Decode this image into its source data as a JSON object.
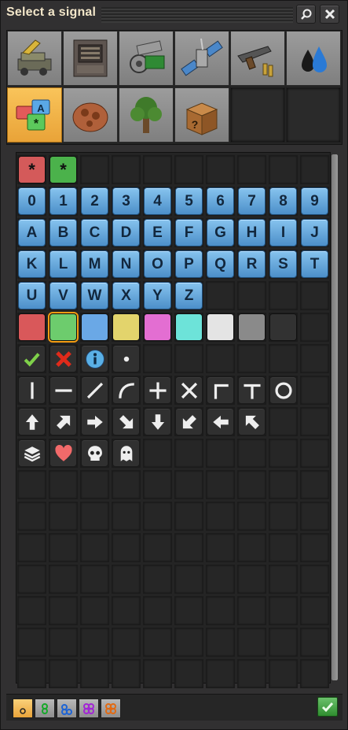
{
  "window": {
    "title": "Select a signal"
  },
  "toolbar": {
    "search_icon": "search-icon",
    "close_icon": "close-icon"
  },
  "groups": [
    {
      "name": "logistics",
      "icon": "logistics-icon",
      "selected": false
    },
    {
      "name": "production",
      "icon": "production-icon",
      "selected": false
    },
    {
      "name": "intermediate-products",
      "icon": "intermediate-icon",
      "selected": false
    },
    {
      "name": "combat-space",
      "icon": "satellite-icon",
      "selected": false
    },
    {
      "name": "combat",
      "icon": "weapons-icon",
      "selected": false
    },
    {
      "name": "fluids",
      "icon": "fluids-icon",
      "selected": false
    },
    {
      "name": "signals",
      "icon": "signals-icon",
      "selected": true
    },
    {
      "name": "enemies",
      "icon": "nest-icon",
      "selected": false
    },
    {
      "name": "environment",
      "icon": "tree-icon",
      "selected": false
    },
    {
      "name": "unsorted",
      "icon": "unknown-box-icon",
      "selected": false
    }
  ],
  "signals": {
    "wildcards": [
      {
        "label": "*",
        "color": "#d45a5a"
      },
      {
        "label": "*",
        "color": "#4bb24b"
      }
    ],
    "digits": [
      "0",
      "1",
      "2",
      "3",
      "4",
      "5",
      "6",
      "7",
      "8",
      "9"
    ],
    "letters_row1": [
      "A",
      "B",
      "C",
      "D",
      "E",
      "F",
      "G",
      "H",
      "I",
      "J"
    ],
    "letters_row2": [
      "K",
      "L",
      "M",
      "N",
      "O",
      "P",
      "Q",
      "R",
      "S",
      "T"
    ],
    "letters_row3": [
      "U",
      "V",
      "W",
      "X",
      "Y",
      "Z"
    ],
    "colors": [
      "#d9585a",
      "#6dcc6d",
      "#6aa8e6",
      "#e3d46c",
      "#e36ed2",
      "#6de3d9",
      "#e4e4e4",
      "#8a8a8a",
      "#323232"
    ],
    "misc_icons": [
      "check-icon",
      "cross-icon",
      "info-icon",
      "dot-icon"
    ],
    "shape_icons": [
      "vertical-line-icon",
      "horizontal-line-icon",
      "diagonal-line-icon",
      "curve-icon",
      "plus-icon",
      "x-icon",
      "corner-icon",
      "tee-icon",
      "circle-icon"
    ],
    "arrow_icons": [
      "up-arrow-icon",
      "up-right-arrow-icon",
      "right-arrow-icon",
      "down-right-arrow-icon",
      "down-arrow-icon",
      "down-left-arrow-icon",
      "left-arrow-icon",
      "up-left-arrow-icon"
    ],
    "status_icons": [
      "layers-icon",
      "heart-icon",
      "skull-icon",
      "ghost-icon"
    ]
  },
  "filters": [
    {
      "name": "quality-normal",
      "color": "#ffffff",
      "selected": true
    },
    {
      "name": "quality-uncommon",
      "color": "#2ecc40",
      "selected": false
    },
    {
      "name": "quality-rare",
      "color": "#2f7ff0",
      "selected": false
    },
    {
      "name": "quality-epic",
      "color": "#b13ae0",
      "selected": false
    },
    {
      "name": "quality-legendary",
      "color": "#f07d1a",
      "selected": false
    }
  ],
  "confirm": {
    "icon": "check-icon"
  }
}
